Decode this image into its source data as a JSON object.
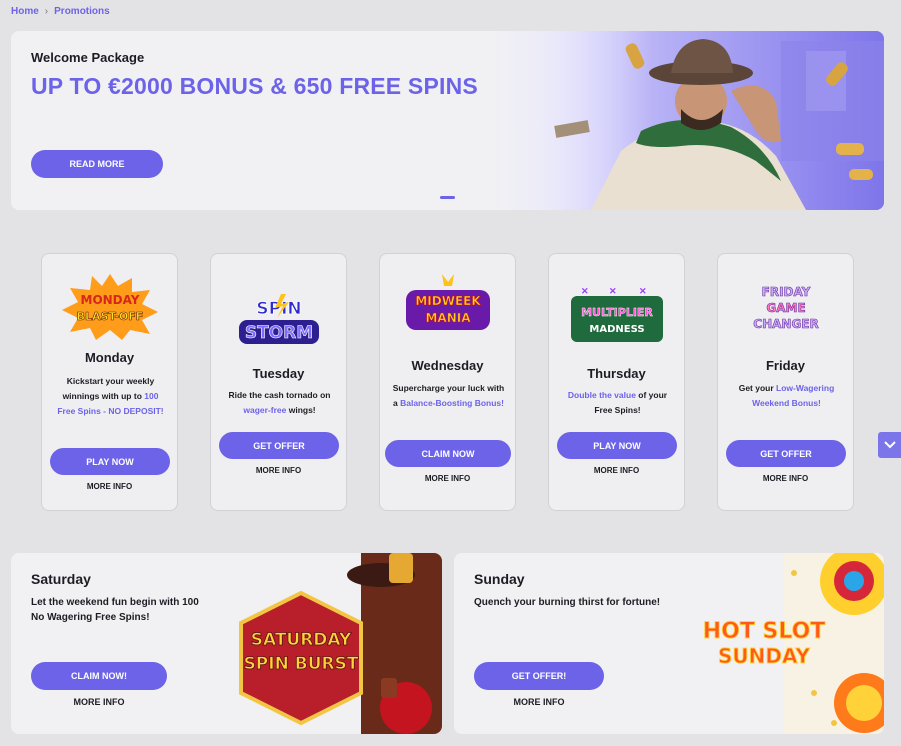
{
  "breadcrumb": {
    "home": "Home",
    "separator": "›",
    "current": "Promotions"
  },
  "hero": {
    "kicker": "Welcome Package",
    "headline": "UP TO €2000 BONUS & 650 FREE SPINS",
    "button": "READ MORE"
  },
  "days": [
    {
      "logo_lines": [
        "MONDAY",
        "BLAST-OFF"
      ],
      "day": "Monday",
      "desc_plain": "Kickstart your weekly winnings with up to ",
      "desc_hl": "100 Free Spins - NO DEPOSIT!",
      "desc_tail": "",
      "button": "PLAY NOW",
      "more": "MORE INFO"
    },
    {
      "logo_lines": [
        "SPIN",
        "STORM"
      ],
      "day": "Tuesday",
      "desc_plain": "Ride the cash tornado on ",
      "desc_hl": "wager-free",
      "desc_tail": " wings!",
      "button": "GET OFFER",
      "more": "MORE INFO"
    },
    {
      "logo_lines": [
        "MIDWEEK",
        "MANIA"
      ],
      "day": "Wednesday",
      "desc_plain": "Supercharge your luck with a ",
      "desc_hl": "Balance-Boosting Bonus!",
      "desc_tail": "",
      "button": "CLAIM NOW",
      "more": "MORE INFO"
    },
    {
      "logo_lines": [
        "MULTIPLIER",
        "MADNESS"
      ],
      "day": "Thursday",
      "desc_plain": "",
      "desc_hl": "Double the value",
      "desc_tail": " of your Free Spins!",
      "button": "PLAY NOW",
      "more": "MORE INFO"
    },
    {
      "logo_lines": [
        "FRIDAY",
        "GAME",
        "CHANGER"
      ],
      "day": "Friday",
      "desc_plain": "Get your ",
      "desc_hl": "Low-Wagering Weekend Bonus!",
      "desc_tail": "",
      "button": "GET OFFER",
      "more": "MORE INFO"
    }
  ],
  "saturday": {
    "title": "Saturday",
    "text": "Let the weekend fun begin with 100 No Wagering Free Spins!",
    "button": "CLAIM NOW!",
    "more": "MORE INFO",
    "logo_lines": [
      "SATURDAY",
      "SPIN BURST"
    ]
  },
  "sunday": {
    "title": "Sunday",
    "text": "Quench your burning thirst for fortune!",
    "button": "GET OFFER!",
    "more": "MORE INFO",
    "logo_lines": [
      "HOT SLOT",
      "SUNDAY"
    ]
  },
  "colors": {
    "accent": "#6c63e8",
    "background": "#e3e3e6",
    "card": "#efeff1"
  }
}
